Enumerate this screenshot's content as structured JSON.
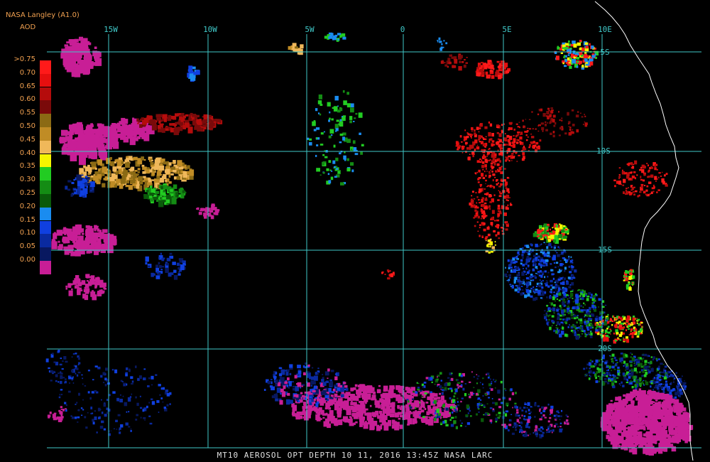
{
  "header": {
    "title": "NASA Langley (A1.0)",
    "subtitle": "AOD"
  },
  "legend": {
    "items": [
      {
        "label": ">0.75",
        "color": "#ff1a1a"
      },
      {
        "label": "0.70",
        "color": "#e60f0f"
      },
      {
        "label": "0.65",
        "color": "#b50c0c"
      },
      {
        "label": "0.60",
        "color": "#7a0a0a"
      },
      {
        "label": "0.55",
        "color": "#8b6a14"
      },
      {
        "label": "0.50",
        "color": "#c08c25"
      },
      {
        "label": "0.45",
        "color": "#f0b85a"
      },
      {
        "label": "0.40",
        "color": "#f5f500"
      },
      {
        "label": "0.35",
        "color": "#22cc22"
      },
      {
        "label": "0.30",
        "color": "#148c14"
      },
      {
        "label": "0.25",
        "color": "#0a5a0a"
      },
      {
        "label": "0.20",
        "color": "#1a8cf0"
      },
      {
        "label": "0.15",
        "color": "#1040e0"
      },
      {
        "label": "0.10",
        "color": "#0a2aa0"
      },
      {
        "label": "0.05",
        "color": "#081860"
      },
      {
        "label": "0.00",
        "color": "#c81e96"
      }
    ]
  },
  "grid": {
    "color": "#40c8c8",
    "lon_labels": [
      "15W",
      "10W",
      "5W",
      "0",
      "5E",
      "10E"
    ],
    "lat_labels": [
      "5S",
      "10S",
      "15S",
      "20S"
    ]
  },
  "colors": {
    "coastline": "#ffffff",
    "label": "#f0a050"
  },
  "footer": {
    "text": "MT10  AEROSOL OPT DEPTH   10 11, 2016 13:45Z   NASA LARC"
  }
}
